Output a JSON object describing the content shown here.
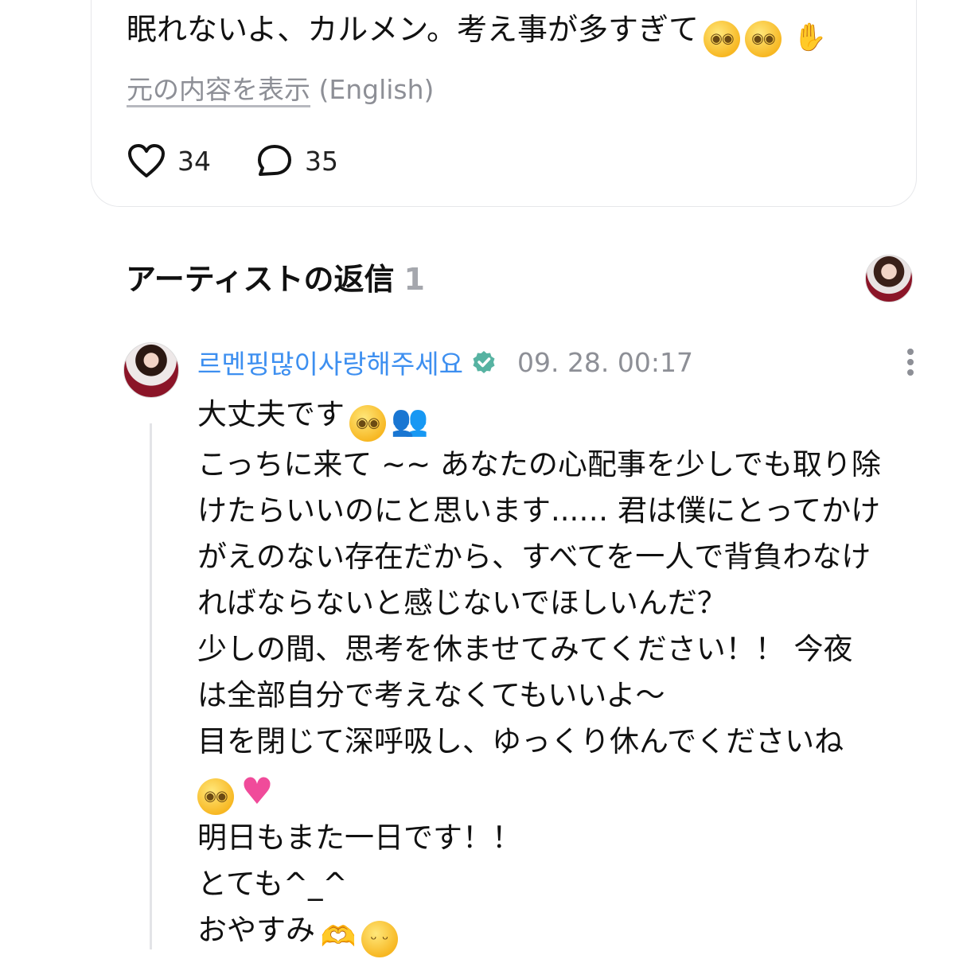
{
  "post": {
    "text": "眠れないよ、カルメン。考え事が多すぎて",
    "emojis": [
      "pleading-face",
      "pleading-face",
      "palm-up-hand"
    ],
    "translate_link": "元の内容を表示",
    "translate_lang": "(English)",
    "likes": "34",
    "comments": "35"
  },
  "artist_replies": {
    "title": "アーティストの返信",
    "count": "1"
  },
  "reply": {
    "author": "르멘핑많이사랑해주세요",
    "verified": true,
    "time": "09. 28. 00:17",
    "lines": [
      "大丈夫です",
      "こっちに来て ~~ あなたの心配事を少しでも取り除",
      "けたらいいのにと思います...… 君は僕にとってかけ",
      "がえのない存在だから、すべてを一人で背負わなけ",
      "ればならないと感じないでほしいんだ？",
      "少しの間、思考を休ませてみてください！！ 今夜",
      "は全部自分で考えなくてもいいよ〜",
      "目を閉じて深呼吸し、ゆっくり休んでくださいね",
      "",
      "明日もまた一日です！！",
      "とても^_^",
      "おやすみ"
    ]
  },
  "colors": {
    "accent_blue": "#3d8ff0",
    "muted_text": "#8d8f96",
    "verified_badge": "#57b3a2"
  },
  "icons": [
    "heart-icon",
    "comment-icon",
    "verified-icon",
    "more-icon"
  ]
}
